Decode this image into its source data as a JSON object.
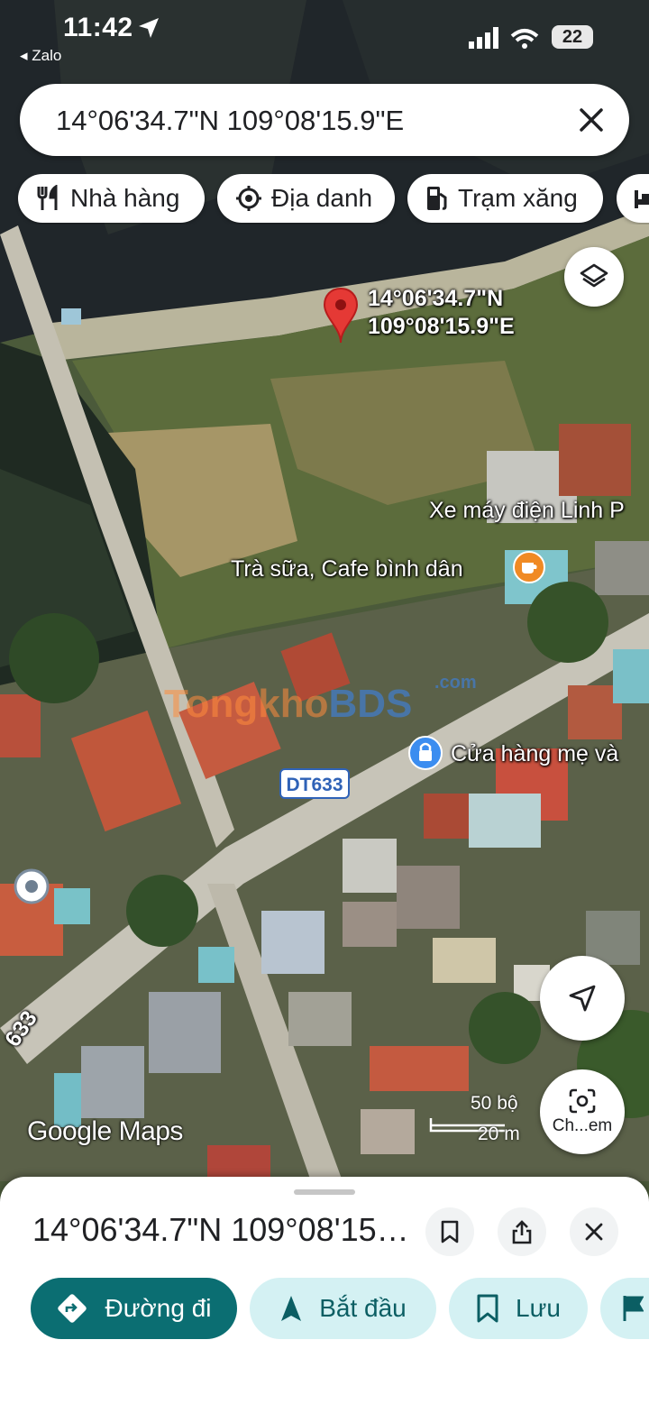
{
  "status_bar": {
    "time": "11:42",
    "back_app": "◂ Zalo",
    "battery": "22"
  },
  "search": {
    "value": "14°06'34.7\"N 109°08'15.9\"E"
  },
  "chips": [
    {
      "label": "Nhà hàng",
      "icon": "restaurant-icon"
    },
    {
      "label": "Địa danh",
      "icon": "landmark-icon"
    },
    {
      "label": "Trạm xăng",
      "icon": "gas-station-icon"
    }
  ],
  "map": {
    "pin_label_line1": "14°06'34.7\"N",
    "pin_label_line2": "109°08'15.9\"E",
    "labels": {
      "xe_may": "Xe máy điện Linh P",
      "tra_sua": "Trà sữa, Cafe bình dân",
      "cua_hang": "Cửa hàng mẹ và"
    },
    "road_badge": "DT633",
    "road_side_label": "633",
    "watermark_main": "Tongkho",
    "watermark_bds": "BDS",
    "watermark_com": ".com",
    "logo": "Google Maps",
    "scale_imperial": "50 bộ",
    "scale_metric": "20 m",
    "lens_label": "Ch...em"
  },
  "sheet": {
    "title": "14°06'34.7\"N 109°08'15.9\"E",
    "actions": [
      {
        "label": "Đường đi",
        "icon": "directions-icon"
      },
      {
        "label": "Bắt đầu",
        "icon": "navigation-icon"
      },
      {
        "label": "Lưu",
        "icon": "bookmark-icon"
      }
    ]
  },
  "colors": {
    "primary_button": "#0b6e72",
    "secondary_button": "#d4f1f3",
    "pin": "#e53935"
  }
}
